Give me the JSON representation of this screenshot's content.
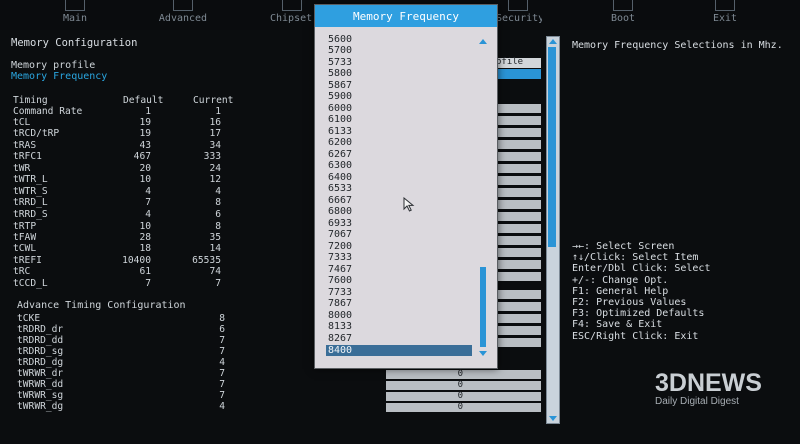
{
  "tabs": [
    {
      "label": "Main"
    },
    {
      "label": "Advanced"
    },
    {
      "label": "Chipset"
    },
    {
      "label": "Security"
    },
    {
      "label": "Boot"
    },
    {
      "label": "Exit"
    }
  ],
  "left": {
    "section_title": "Memory Configuration",
    "memory_profile": "Memory profile",
    "memory_frequency": "Memory Frequency",
    "profile_box_value": "ofile",
    "timing_header": {
      "name": "Timing",
      "default": "Default",
      "current": "Current"
    },
    "timings": [
      {
        "name": "Command Rate",
        "default": "1",
        "current": "1"
      },
      {
        "name": "tCL",
        "default": "19",
        "current": "16"
      },
      {
        "name": "tRCD/tRP",
        "default": "19",
        "current": "17"
      },
      {
        "name": "tRAS",
        "default": "43",
        "current": "34"
      },
      {
        "name": "tRFC1",
        "default": "467",
        "current": "333"
      },
      {
        "name": "tWR",
        "default": "20",
        "current": "24"
      },
      {
        "name": "tWTR_L",
        "default": "10",
        "current": "12"
      },
      {
        "name": "tWTR_S",
        "default": "4",
        "current": "4"
      },
      {
        "name": "tRRD_L",
        "default": "7",
        "current": "8"
      },
      {
        "name": "tRRD_S",
        "default": "4",
        "current": "6"
      },
      {
        "name": "tRTP",
        "default": "10",
        "current": "8"
      },
      {
        "name": "tFAW",
        "default": "28",
        "current": "35"
      },
      {
        "name": "tCWL",
        "default": "18",
        "current": "14"
      },
      {
        "name": "tREFI",
        "default": "10400",
        "current": "65535"
      },
      {
        "name": "tRC",
        "default": "61",
        "current": "74"
      },
      {
        "name": "tCCD_L",
        "default": "7",
        "current": "7"
      }
    ],
    "advance_title": "Advance Timing Configuration",
    "advance": [
      {
        "name": "tCKE",
        "value": "8"
      },
      {
        "name": "tRDRD_dr",
        "value": "6"
      },
      {
        "name": "tRDRD_dd",
        "value": "7"
      },
      {
        "name": "tRDRD_sg",
        "value": "7"
      },
      {
        "name": "tRDRD_dg",
        "value": "4"
      },
      {
        "name": "tWRWR_dr",
        "value": "7"
      },
      {
        "name": "tWRWR_dd",
        "value": "7"
      },
      {
        "name": "tWRWR_sg",
        "value": "7"
      },
      {
        "name": "tWRWR_dg",
        "value": "4"
      }
    ],
    "right_zero_values": [
      "0",
      "0",
      "0",
      "0"
    ]
  },
  "popup": {
    "title": "Memory Frequency",
    "options": [
      "5600",
      "5700",
      "5733",
      "5800",
      "5867",
      "5900",
      "6000",
      "6100",
      "6133",
      "6200",
      "6267",
      "6300",
      "6400",
      "6533",
      "6667",
      "6800",
      "6933",
      "7067",
      "7200",
      "7333",
      "7467",
      "7600",
      "7733",
      "7867",
      "8000",
      "8133",
      "8267",
      "8400"
    ],
    "selected": "8400"
  },
  "help": {
    "description": "Memory Frequency Selections in Mhz.",
    "keys": [
      "→←: Select Screen",
      "↑↓/Click: Select Item",
      "Enter/Dbl Click: Select",
      "+/-: Change Opt.",
      "F1: General Help",
      "F2: Previous Values",
      "F3: Optimized Defaults",
      "F4: Save & Exit",
      "ESC/Right Click: Exit"
    ]
  },
  "watermark": {
    "brand": "3DNEWS",
    "tagline": "Daily Digital Digest"
  }
}
